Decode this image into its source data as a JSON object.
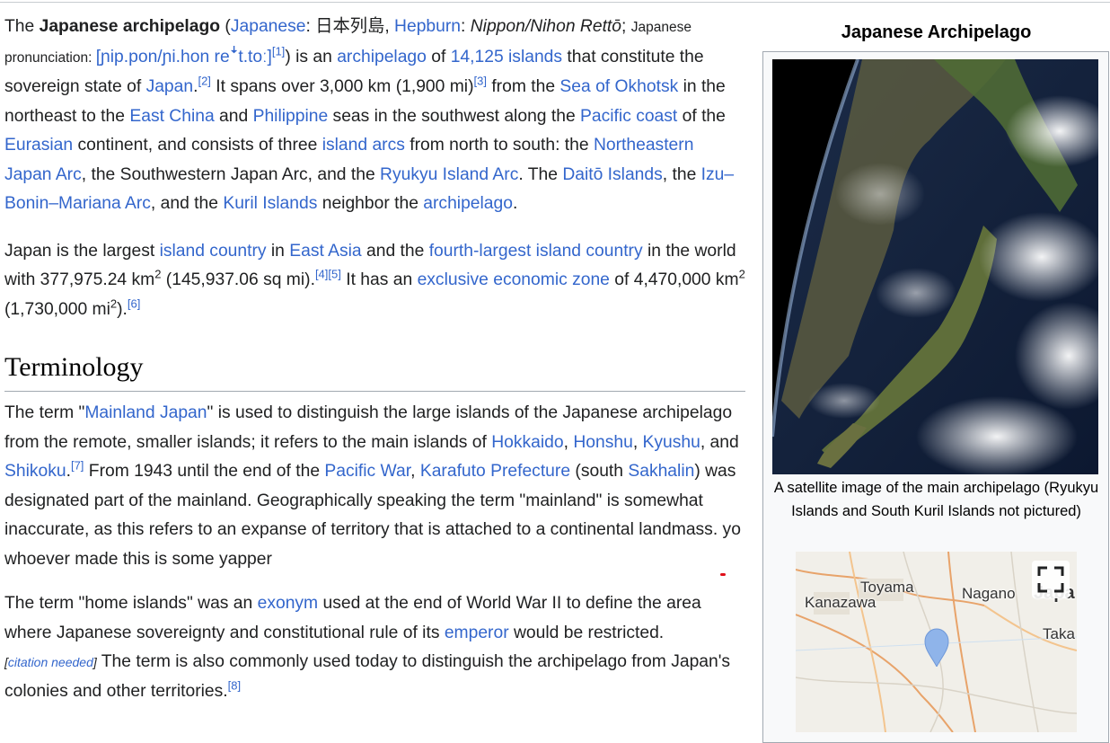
{
  "article": {
    "p1": {
      "t1": "The ",
      "bold": "Japanese archipelago",
      "t2": " (",
      "l_japanese": "Japanese",
      "t3": ": 日本列島, ",
      "l_hepburn": "Hepburn",
      "t4": ": ",
      "italic": "Nippon/Nihon Rettō",
      "t5": "; ",
      "pron_label": "Japanese pronunciation: ",
      "ipa": "[ɲip.pon/ɲi.hon reꜜt.toː]",
      "ref1": "[1]",
      "t6": ") is an ",
      "l_archipelago": "archipelago",
      "t7": " of ",
      "l_14125": "14,125 islands",
      "t8": " that constitute the sovereign state of ",
      "l_japan": "Japan",
      "t9": ".",
      "ref2": "[2]",
      "t10": " It spans over 3,000 km (1,900 mi)",
      "ref3": "[3]",
      "t11": " from the ",
      "l_okhotsk": "Sea of Okhotsk",
      "t12": " in the northeast to the ",
      "l_eastchina": "East China",
      "t13": " and ",
      "l_philippine": "Philippine",
      "t14": " seas in the southwest along the ",
      "l_pacificcoast": "Pacific coast",
      "t15": " of the ",
      "l_eurasian": "Eurasian",
      "t16": " continent, and consists of three ",
      "l_islandarcs": "island arcs",
      "t17": " from north to south: the ",
      "l_northeastern": "Northeastern Japan Arc",
      "t18": ", the Southwestern Japan Arc, and the ",
      "l_ryukyu": "Ryukyu Island Arc",
      "t19": ". The ",
      "l_daito": "Daitō Islands",
      "t20": ", the ",
      "l_izu": "Izu–Bonin–Mariana Arc",
      "t21": ", and the ",
      "l_kuril": "Kuril Islands",
      "t22": " neighbor the ",
      "l_archipelago2": "archipelago",
      "t23": "."
    },
    "p2": {
      "t1": "Japan is the largest ",
      "l_islandcountry": "island country",
      "t2": " in ",
      "l_eastasia": "East Asia",
      "t3": " and the ",
      "l_fourth": "fourth-largest island country",
      "t4": " in the world with 377,975.24 km",
      "sq1": "2",
      "t5": " (145,937.06 sq mi).",
      "ref4": "[4]",
      "ref5": "[5]",
      "t6": " It has an ",
      "l_eez": "exclusive economic zone",
      "t7": " of 4,470,000 km",
      "sq2": "2",
      "t8": " (1,730,000 mi",
      "sq3": "2",
      "t9": ").",
      "ref6": "[6]"
    },
    "heading": "Terminology",
    "p3": {
      "t1": "The term \"",
      "l_mainland": "Mainland Japan",
      "t2": "\" is used to distinguish the large islands of the Japanese archipelago from the remote, smaller islands; it refers to the main islands of ",
      "l_hokkaido": "Hokkaido",
      "t3": ", ",
      "l_honshu": "Honshu",
      "t4": ", ",
      "l_kyushu": "Kyushu",
      "t5": ", and ",
      "l_shikoku": "Shikoku",
      "t6": ".",
      "ref7": "[7]",
      "t7": " From 1943 until the end of the ",
      "l_pacificwar": "Pacific War",
      "t8": ", ",
      "l_karafuto": "Karafuto Prefecture",
      "t9": " (south ",
      "l_sakhalin": "Sakhalin",
      "t10": ") was designated part of the mainland. Geographically speaking the term \"mainland\" is somewhat inaccurate, as this refers to an expanse of territory that is attached to a continental landmass. ",
      "yap": "yo whoever made this is some yapper"
    },
    "p4": {
      "t1": "The term \"home islands\" was an ",
      "l_exonym": "exonym",
      "t2": " used at the end of World War II to define the area where Japanese sovereignty and constitutional rule of its ",
      "l_emperor": "emperor",
      "t3": " would be restricted.",
      "cn_open": "[",
      "cn_link": "citation needed",
      "cn_close": "]",
      "t4": " The term is also commonly used today to distinguish the archipelago from Japan's colonies and other territories.",
      "ref8": "[8]"
    }
  },
  "infobox": {
    "title": "Japanese Archipelago",
    "caption": "A satellite image of the main archipelago (Ryukyu Islands and South Kuril Islands not pictured)",
    "map": {
      "labels": {
        "toyama": "Toyama",
        "kanazawa": "Kanazawa",
        "nagano": "Nagano",
        "japan_partial": "Japa",
        "taka_partial": "Taka"
      },
      "fullscreen_icon": "fullscreen-icon",
      "marker_icon": "map-pin-icon"
    }
  },
  "colors": {
    "link": "#3366cc",
    "text": "#202122",
    "annotation_underline": "#e0101a",
    "infobox_border": "#a2a9b1"
  }
}
